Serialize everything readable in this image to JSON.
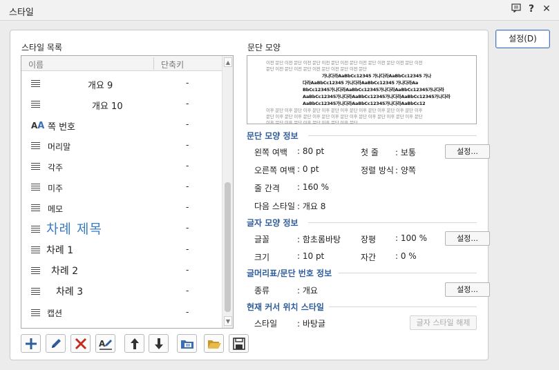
{
  "window": {
    "title": "스타일",
    "controls": [
      "chat-icon",
      "help-icon",
      "close-icon"
    ],
    "help_glyph": "?",
    "close_glyph": "✕"
  },
  "settings_button": "설정(D)",
  "style_list": {
    "label": "스타일 목록",
    "col_name": "이름",
    "col_shortcut": "단축키",
    "items": [
      {
        "name": "개요 9",
        "shortcut": "-",
        "type": "para"
      },
      {
        "name": "개요 10",
        "shortcut": "-",
        "type": "para"
      },
      {
        "name": "쪽 번호",
        "shortcut": "-",
        "type": "char"
      },
      {
        "name": "머리말",
        "shortcut": "-",
        "type": "para"
      },
      {
        "name": "각주",
        "shortcut": "-",
        "type": "para"
      },
      {
        "name": "미주",
        "shortcut": "-",
        "type": "para"
      },
      {
        "name": "메모",
        "shortcut": "-",
        "type": "para"
      },
      {
        "name": "차례 제목",
        "shortcut": "-",
        "type": "para"
      },
      {
        "name": "차례 1",
        "shortcut": "-",
        "type": "para"
      },
      {
        "name": "차례 2",
        "shortcut": "-",
        "type": "para"
      },
      {
        "name": "차례 3",
        "shortcut": "-",
        "type": "para"
      },
      {
        "name": "캡션",
        "shortcut": "-",
        "type": "para"
      }
    ]
  },
  "paragraph_preview": {
    "label": "문단 모양",
    "gray_line": "이전 문단 이전 문단 이전 문단 이전 문단 이전 문단 이전 문단 이전 문단 이전 문단 이전",
    "gray_line_2": "문단 이전 문단 이전 문단 이전 문단 이전 문단 이전 문단",
    "sample_1": "가나다라AaBbCc12345 가나다라AaBbCc12345 가나",
    "sample_2": "다라AaBbCc12345 가나다라AaBbCc12345 가나다라Aa",
    "sample_3": "BbCc12345가나다라AaBbCc12345가나다라AaBbCc12345가나다라",
    "sample_4": "AaBbCc12345가나다라AaBbCc12345가나다라AaBbCc12345가나다라",
    "sample_5": "AaBbCc12345가나다라AaBbCc12345가나다라AaBbCc12345가나다라",
    "sample_6": "AaBbCc12345가나다라AaBbCc12345가나다라AaBbCc12",
    "after_line": "이후 문단 이후 문단 이후 문단 이후 문단 이후 문단 이후 문단 이후 문단 이후 문단 이후",
    "after_line_2": "문단 이후 문단 이후 문단 이후 문단 이후 문단 이후 문단 이후 문단 이후 문단 이후 문단",
    "after_line_3": "이후 문단 이후 문단 이후 문단 이후 문단 이후 문단"
  },
  "paragraph_info": {
    "heading": "문단 모양 정보",
    "left_margin_label": "왼쪽 여백",
    "left_margin_value": ": 80 pt",
    "right_margin_label": "오른쪽 여백",
    "right_margin_value": ": 0 pt",
    "line_spacing_label": "줄 간격",
    "line_spacing_value": ": 160 %",
    "next_style_label": "다음 스타일",
    "next_style_value": ": 개요 8",
    "first_line_label": "첫 줄",
    "first_line_value": ": 보통",
    "align_label": "정렬 방식",
    "align_value": ": 양쪽",
    "settings_btn": "설정..."
  },
  "char_info": {
    "heading": "글자 모양 정보",
    "font_label": "글꼴",
    "font_value": ": 함초롬바탕",
    "size_label": "크기",
    "size_value": ": 10 pt",
    "width_label": "장평",
    "width_value": ": 100 %",
    "spacing_label": "자간",
    "spacing_value": ": 0 %",
    "settings_btn": "설정..."
  },
  "bullet_info": {
    "heading": "글머리표/문단 번호 정보",
    "kind_label": "종류",
    "kind_value": ": 개요",
    "settings_btn": "설정..."
  },
  "cursor_style": {
    "heading": "현재 커서 위치 스타일",
    "style_label": "스타일",
    "style_value": ": 바탕글",
    "release_btn": "글자 스타일 해제"
  },
  "toolbar": [
    "add-icon",
    "edit-icon",
    "delete-icon",
    "replace-style-icon",
    "move-up-icon",
    "move-down-icon",
    "import-icon",
    "open-folder-icon",
    "save-icon"
  ],
  "colors": {
    "accent": "#2f5c9a",
    "delete_red": "#c42b1c",
    "highlight_blue": "#3b6db5"
  }
}
